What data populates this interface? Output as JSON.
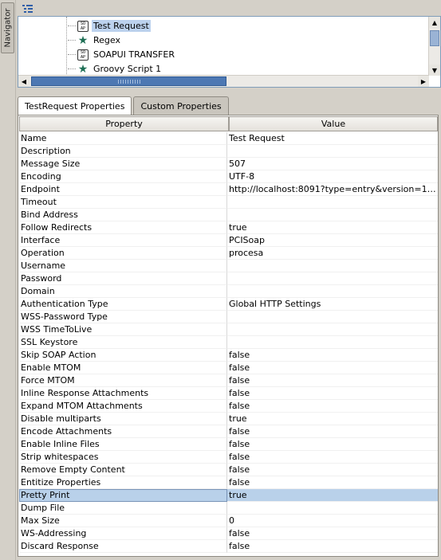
{
  "navigator": {
    "tab_label": "Navigator"
  },
  "tree": {
    "items": [
      {
        "label": "Test Request",
        "icon": "soap-request-icon",
        "selected": true
      },
      {
        "label": "Regex",
        "icon": "star-icon"
      },
      {
        "label": "SOAPUI TRANSFER",
        "icon": "soap-request-icon"
      },
      {
        "label": "Groovy Script 1",
        "icon": "star-icon"
      }
    ]
  },
  "tabs": [
    {
      "label": "TestRequest Properties",
      "active": true
    },
    {
      "label": "Custom Properties",
      "active": false
    }
  ],
  "table": {
    "columns": {
      "property": "Property",
      "value": "Value"
    },
    "rows": [
      {
        "name": "Name",
        "value": "Test Request"
      },
      {
        "name": "Description",
        "value": ""
      },
      {
        "name": "Message Size",
        "value": "507"
      },
      {
        "name": "Encoding",
        "value": "UTF-8"
      },
      {
        "name": "Endpoint",
        "value": "http://localhost:8091?type=entry&version=1.0..."
      },
      {
        "name": "Timeout",
        "value": ""
      },
      {
        "name": "Bind Address",
        "value": ""
      },
      {
        "name": "Follow Redirects",
        "value": "true"
      },
      {
        "name": "Interface",
        "value": "PCISoap"
      },
      {
        "name": "Operation",
        "value": "procesa"
      },
      {
        "name": "Username",
        "value": ""
      },
      {
        "name": "Password",
        "value": ""
      },
      {
        "name": "Domain",
        "value": ""
      },
      {
        "name": "Authentication Type",
        "value": "Global HTTP Settings"
      },
      {
        "name": "WSS-Password Type",
        "value": ""
      },
      {
        "name": "WSS TimeToLive",
        "value": ""
      },
      {
        "name": "SSL Keystore",
        "value": ""
      },
      {
        "name": "Skip SOAP Action",
        "value": "false"
      },
      {
        "name": "Enable MTOM",
        "value": "false"
      },
      {
        "name": "Force MTOM",
        "value": "false"
      },
      {
        "name": "Inline Response Attachments",
        "value": "false"
      },
      {
        "name": "Expand MTOM Attachments",
        "value": "false"
      },
      {
        "name": "Disable multiparts",
        "value": "true"
      },
      {
        "name": "Encode Attachments",
        "value": "false"
      },
      {
        "name": "Enable Inline Files",
        "value": "false"
      },
      {
        "name": "Strip whitespaces",
        "value": "false"
      },
      {
        "name": "Remove Empty Content",
        "value": "false"
      },
      {
        "name": "Entitize Properties",
        "value": "false"
      },
      {
        "name": "Pretty Print",
        "value": "true",
        "selected": true
      },
      {
        "name": "Dump File",
        "value": ""
      },
      {
        "name": "Max Size",
        "value": "0"
      },
      {
        "name": "WS-Addressing",
        "value": "false"
      },
      {
        "name": "Discard Response",
        "value": "false"
      }
    ]
  },
  "colors": {
    "selection": "#b9d1ea",
    "tree_selection": "#bcd2ee",
    "scroll_thumb": "#4d78b3"
  }
}
